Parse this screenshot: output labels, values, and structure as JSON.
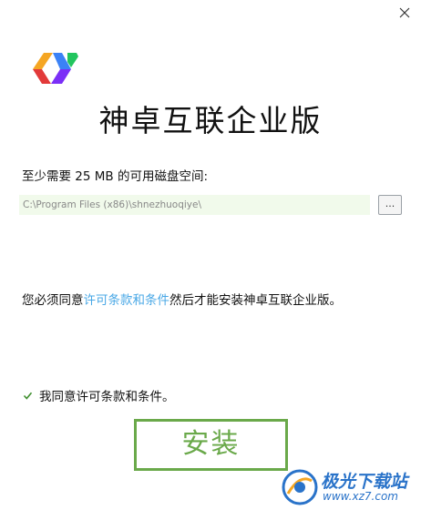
{
  "window": {
    "close_icon": "close-icon"
  },
  "app": {
    "title": "神卓互联企业版",
    "logo_colors": [
      "#e23a3a",
      "#f5a623",
      "#3b82f6",
      "#7b2ff7"
    ]
  },
  "install_path": {
    "space_label": "至少需要 25 MB 的可用磁盘空间:",
    "value": "C:\\Program Files (x86)\\shnezhuoqiye\\",
    "browse_label": "..."
  },
  "license": {
    "prefix": "您必须同意",
    "link_text": "许可条款和条件",
    "suffix": "然后才能安装神卓互联企业版。",
    "link_color": "#4aa8e6"
  },
  "agree": {
    "checked": true,
    "label": "我同意许可条款和条件。"
  },
  "install_button": {
    "label": "安装",
    "accent": "#6aa94a"
  },
  "watermark": {
    "brand": "极光下载站",
    "url": "www.xz7.com"
  }
}
